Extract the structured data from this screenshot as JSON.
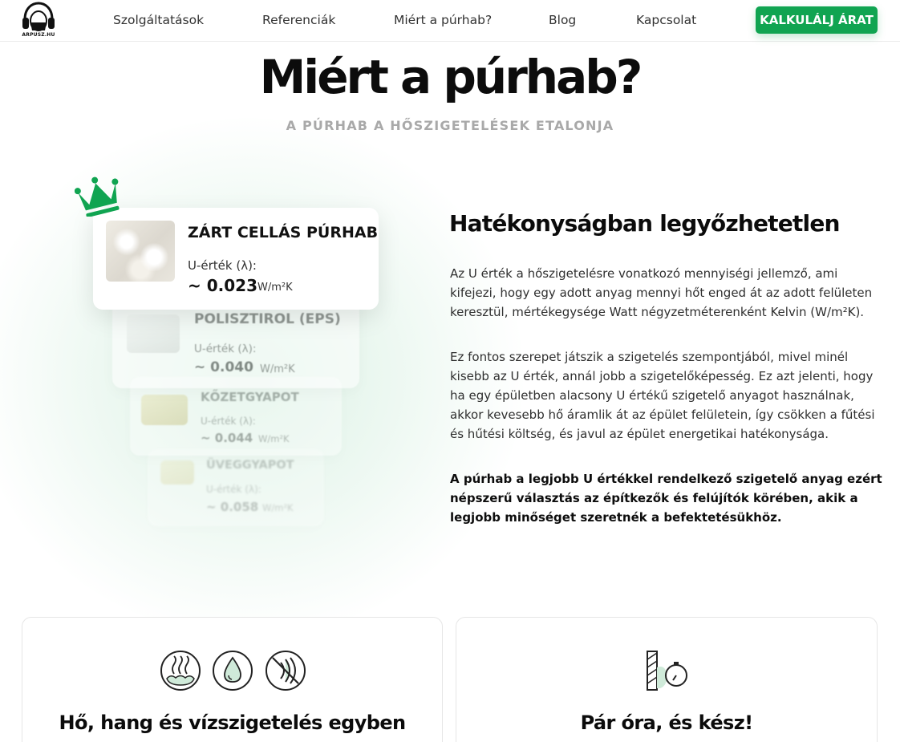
{
  "header": {
    "logo_text": "ARPUSZ.HU",
    "nav": [
      "Szolgáltatások",
      "Referenciák",
      "Miért a púrhab?",
      "Blog",
      "Kapcsolat"
    ],
    "cta_label": "KALKULÁLJ ÁRAT"
  },
  "hero": {
    "title": "Miért a púrhab?",
    "subtitle": "A PÚRHAB A HŐSZIGETELÉSEK ETALONJA"
  },
  "materials": [
    {
      "name": "ZÁRT CELLÁS PÚRHAB",
      "u_label": "U-érték (λ):",
      "u_value": "~ 0.023",
      "unit": "W/m²K",
      "icon": "crown-icon"
    },
    {
      "name": "POLISZTIROL (EPS)",
      "u_label": "U-érték (λ):",
      "u_value": "~ 0.040",
      "unit": "W/m²K"
    },
    {
      "name": "KŐZETGYAPOT",
      "u_label": "U-érték (λ):",
      "u_value": "~ 0.044",
      "unit": "W/m²K"
    },
    {
      "name": "ÜVEGGYAPOT",
      "u_label": "U-érték (λ):",
      "u_value": "~ 0.058",
      "unit": "W/m²K"
    }
  ],
  "content": {
    "heading": "Hatékonyságban legyőzhetetlen",
    "p1": "Az U érték a hőszigetelésre vonatkozó mennyiségi jellemző, ami kifejezi, hogy egy adott anyag mennyi hőt enged át az adott felületen keresztül, mértékegysége Watt négyzetméterenként Kelvin (W/m²K).",
    "p2": "Ez fontos szerepet játszik a szigetelés szempontjából, mivel minél kisebb az U érték, annál jobb a szigetelőképesség. Ez azt jelenti, hogy ha egy épületben alacsony U értékű szigetelő anyagot használnak, akkor kevesebb hő áramlik át az épület felületein, így csökken a fűtési és hűtési költség, és javul az épület energetikai hatékonysága.",
    "p3": "A púrhab a legjobb U értékkel rendelkező szigetelő anyag ezért népszerű választás az építkezők és felújítók körében, akik a legjobb minőséget szeretnék a befektetésükhöz."
  },
  "features": [
    {
      "title": "Hő, hang és vízszigetelés egyben",
      "icons": [
        "heat-insulation-icon",
        "water-drop-icon",
        "sound-blocked-icon"
      ]
    },
    {
      "title": "Pár óra, és kész!",
      "icons": [
        "wall-timer-icon"
      ]
    }
  ],
  "colors": {
    "accent": "#10a451",
    "text": "#111111",
    "muted": "#a9a9a9"
  }
}
